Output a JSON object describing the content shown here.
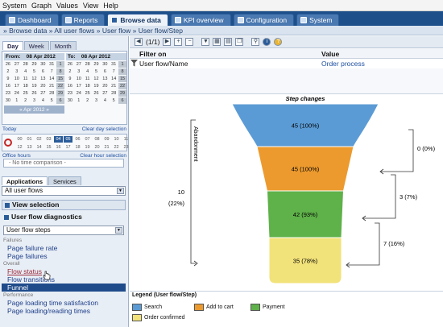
{
  "menu": [
    "System",
    "Graph",
    "Values",
    "View",
    "Help"
  ],
  "tabs": [
    {
      "label": "Dashboard",
      "active": false
    },
    {
      "label": "Reports",
      "active": false
    },
    {
      "label": "Browse data",
      "active": true
    },
    {
      "label": "KPI overview",
      "active": false
    },
    {
      "label": "Configuration",
      "active": false
    },
    {
      "label": "System",
      "active": false
    }
  ],
  "breadcrumb": "» Browse data  » All user flows  » User flow  » User flow/Step",
  "period_tabs": [
    "Day",
    "Week",
    "Month"
  ],
  "calendar": {
    "from_label": "From:",
    "from_date": "08 Apr 2012",
    "to_label": "To:",
    "to_date": "08 Apr 2012",
    "month_label": "« Apr 2012 »",
    "days": [
      "26",
      "27",
      "28",
      "29",
      "30",
      "31",
      "1",
      "2",
      "3",
      "4",
      "5",
      "6",
      "7",
      "8",
      "9",
      "10",
      "11",
      "12",
      "13",
      "14",
      "15",
      "16",
      "17",
      "18",
      "19",
      "20",
      "21",
      "22",
      "23",
      "24",
      "25",
      "26",
      "27",
      "28",
      "29",
      "30",
      "1",
      "2",
      "3",
      "4",
      "5",
      "6"
    ]
  },
  "today_link": "Today",
  "clear_day": "Clear day selection",
  "hours_row1": [
    "00",
    "01",
    "02",
    "03",
    "04",
    "05",
    "06",
    "07",
    "08",
    "09",
    "10",
    "11"
  ],
  "hours_row2": [
    "12",
    "13",
    "14",
    "15",
    "16",
    "17",
    "18",
    "19",
    "20",
    "21",
    "22",
    "23"
  ],
  "office_hours": "Office hours",
  "clear_hour": "Clear hour selection",
  "comparison": "- No time comparison -",
  "left_tabs": [
    "Applications",
    "Services"
  ],
  "flow_select": "All user flows",
  "view_selection": "View selection",
  "diagnostics": "User flow diagnostics",
  "steps_select": "User flow steps",
  "groups": {
    "failures": "Failures",
    "overall": "Overall",
    "performance": "Performance"
  },
  "nav": {
    "page_failure_rate": "Page failure rate",
    "page_failures": "Page failures",
    "flow_status": "Flow status",
    "flow_transitions": "Flow transitions",
    "funnel": "Funnel",
    "page_loading_time": "Page loading time satisfaction",
    "page_loading_reading": "Page loading/reading times"
  },
  "toolbar": {
    "pager": "(1/1)"
  },
  "filter": {
    "col_filter": "Filter on",
    "col_value": "Value",
    "row_filter": "User flow/Name",
    "row_value": "Order process"
  },
  "chart_data": {
    "type": "funnel",
    "title": "Step changes",
    "abandonment_label": "Abandonment",
    "abandonment_total": "10",
    "abandonment_total_pct": "(22%)",
    "steps": [
      {
        "name": "Search",
        "value": 45,
        "label": "45 (100%)",
        "color": "#5b9bd5"
      },
      {
        "name": "Add to cart",
        "value": 45,
        "label": "45 (100%)",
        "color": "#ec9a2e"
      },
      {
        "name": "Payment",
        "value": 42,
        "label": "42 (93%)",
        "color": "#5fb14a"
      },
      {
        "name": "Order confirmed",
        "value": 35,
        "label": "35 (78%)",
        "color": "#f2e27a"
      }
    ],
    "changes": [
      "0 (0%)",
      "3 (7%)",
      "7 (16%)"
    ],
    "legend_title": "Legend (User flow/Step)"
  }
}
